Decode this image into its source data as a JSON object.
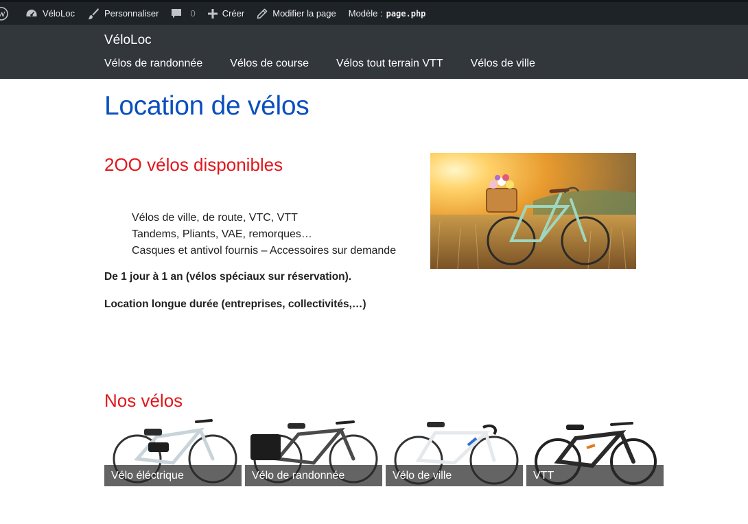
{
  "admin_bar": {
    "site": "VéloLoc",
    "customize": "Personnaliser",
    "comments_count": "0",
    "new": "Créer",
    "edit_page": "Modifier la page",
    "template_label": "Modèle :",
    "template_file": "page.php"
  },
  "header": {
    "site_title": "VéloLoc",
    "nav": [
      "Vélos de randonnée",
      "Vélos de course",
      "Vélos tout terrain VTT",
      "Vélos de ville"
    ]
  },
  "main": {
    "page_title": "Location de vélos",
    "intro_heading": "2OO vélos disponibles",
    "features": [
      "Vélos de ville, de route, VTC, VTT",
      "Tandems, Pliants, VAE, remorques…",
      "Casques et antivol fournis – Accessoires sur demande"
    ],
    "paragraph_duration": "De 1 jour à 1 an (vélos spéciaux sur réservation).",
    "paragraph_long_term": "Location longue durée (entreprises, collectivités,…)",
    "section_heading": "Nos vélos",
    "gallery": [
      {
        "caption": "Vélo éléctrique"
      },
      {
        "caption": "Vélo de randonnée"
      },
      {
        "caption": "Vélo de ville"
      },
      {
        "caption": "VTT"
      }
    ]
  },
  "colors": {
    "admin_bar_bg": "#1d2327",
    "header_bg": "#32373c",
    "title_blue": "#0a4fbf",
    "heading_red": "#e2161b"
  }
}
